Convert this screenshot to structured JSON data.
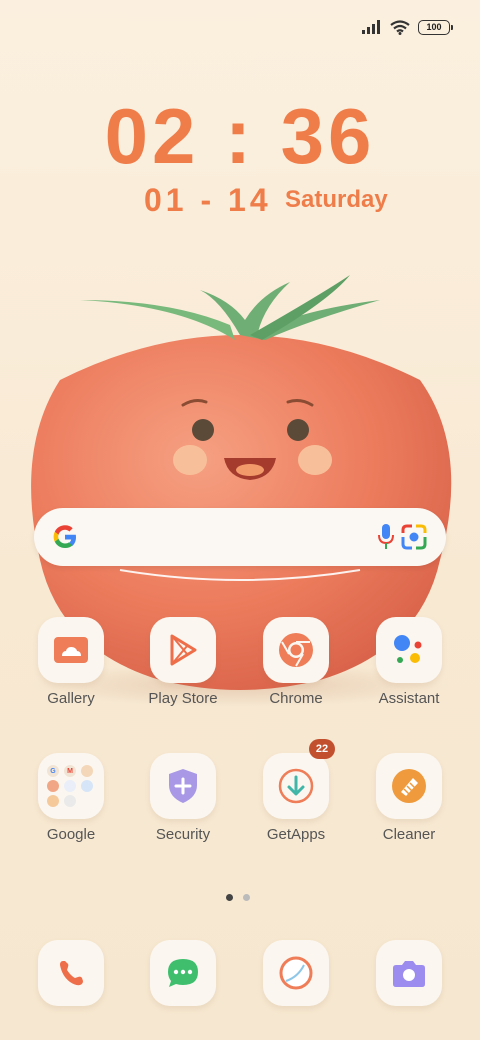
{
  "status_bar": {
    "battery": "100"
  },
  "clock": {
    "time": "02 : 36",
    "date": "01 - 14",
    "day": "Saturday"
  },
  "apps_row1": [
    {
      "label": "Gallery",
      "icon": "gallery-icon"
    },
    {
      "label": "Play Store",
      "icon": "play-store-icon"
    },
    {
      "label": "Chrome",
      "icon": "chrome-icon"
    },
    {
      "label": "Assistant",
      "icon": "assistant-icon"
    }
  ],
  "apps_row2": [
    {
      "label": "Google",
      "icon": "google-folder-icon"
    },
    {
      "label": "Security",
      "icon": "security-icon"
    },
    {
      "label": "GetApps",
      "icon": "getapps-icon",
      "badge": "22"
    },
    {
      "label": "Cleaner",
      "icon": "cleaner-icon"
    }
  ],
  "dock": [
    {
      "icon": "phone-icon"
    },
    {
      "icon": "messages-icon"
    },
    {
      "icon": "browser-icon"
    },
    {
      "icon": "camera-icon"
    }
  ],
  "page_indicator": {
    "pages": 2,
    "current": 1
  },
  "colors": {
    "accent": "#ef7d4a",
    "background": "#fbf0df",
    "badge": "#c2502f"
  }
}
